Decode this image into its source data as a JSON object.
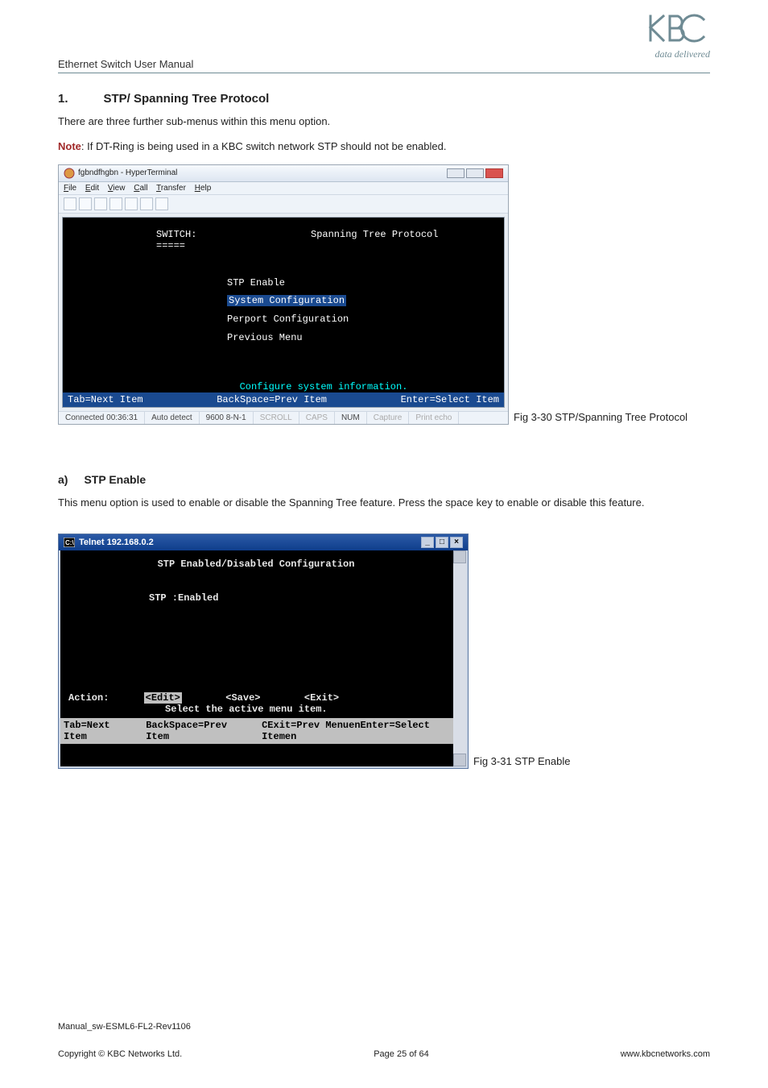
{
  "logo": {
    "tagline": "data delivered"
  },
  "header": {
    "label": "Ethernet Switch User Manual"
  },
  "section": {
    "num": "1.",
    "title": "STP/ Spanning Tree Protocol",
    "para1": "There are three further sub-menus within this menu option.",
    "note_label": "Note",
    "note_body": ": If DT-Ring is being used in a KBC switch network STP should not be enabled."
  },
  "fig1": {
    "caption": "Fig 3-30 STP/Spanning Tree Protocol",
    "window_title": "fgbndfhgbn - HyperTerminal",
    "menus": {
      "file": "File",
      "edit": "Edit",
      "view": "View",
      "call": "Call",
      "transfer": "Transfer",
      "help": "Help"
    },
    "switch_label": "SWITCH:",
    "switch_underline": "=====",
    "heading": "Spanning Tree Protocol",
    "menu_items": [
      "STP Enable",
      "System Configuration",
      "Perport Configuration",
      "Previous Menu"
    ],
    "selected_index": 1,
    "hint": "Configure system information.",
    "footer": {
      "left": "Tab=Next Item",
      "center": "BackSpace=Prev Item",
      "right": "Enter=Select Item"
    },
    "status": {
      "conn": "Connected 00:36:31",
      "detect": "Auto detect",
      "baud": "9600 8-N-1",
      "scroll": "SCROLL",
      "caps": "CAPS",
      "num": "NUM",
      "capture": "Capture",
      "echo": "Print echo"
    }
  },
  "subsection": {
    "num": "a)",
    "title": "STP Enable",
    "para": "This menu option is used to enable or disable the Spanning Tree feature. Press the space key to enable or disable this feature."
  },
  "fig2": {
    "caption": "Fig 3-31 STP Enable",
    "window_title": "Telnet 192.168.0.2",
    "heading": "STP Enabled/Disabled Configuration",
    "kv_label": "STP :",
    "kv_value": "Enabled",
    "action_label": "Action:",
    "edit": "<Edit>",
    "save": "<Save>",
    "exit": "<Exit>",
    "hint": "Select the active menu item.",
    "footer": {
      "tab": "Tab=Next Item",
      "back": "BackSpace=Prev Item",
      "rest": "CExit=Prev MenuenEnter=Select Itemen"
    }
  },
  "footer": {
    "manual_id": "Manual_sw-ESML6-FL2-Rev1106",
    "copyright": "Copyright © KBC Networks Ltd.",
    "page": "Page 25 of 64",
    "url": "www.kbcnetworks.com"
  }
}
